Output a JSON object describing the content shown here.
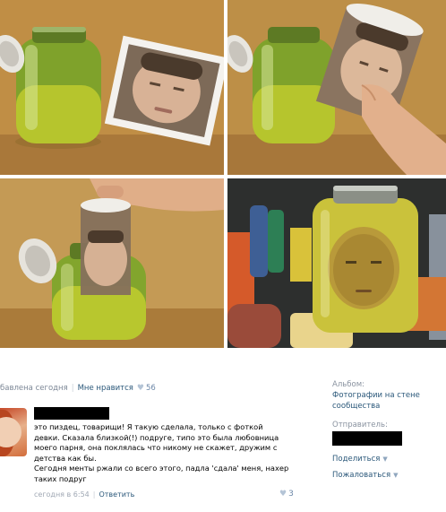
{
  "post": {
    "added_label": "бавлена сегодня",
    "like_label": "Мне нравится",
    "like_count": "56"
  },
  "comment": {
    "lines": [
      "это пиздец, товарищи! Я такую сделала, только с фоткой",
      "девки. Сказала близкой(!) подруге, типо это была любовница",
      "моего парня, она поклялась что никому не скажет, дружим с",
      "детства как бы.",
      "Сегодня менты ржали со всего этого, падла 'сдала' меня, нахер",
      "таких подруг"
    ],
    "time": "сегодня в 6:54",
    "reply_label": "Ответить",
    "like_count": "3"
  },
  "sidebar": {
    "album_label": "Альбом:",
    "album_link": "Фотографии на стене сообщества",
    "sender_label": "Отправитель:",
    "share_label": "Поделиться",
    "report_label": "Пожаловаться"
  },
  "icons": {
    "heart": "heart-icon",
    "dropdown": "chevron-down-icon"
  },
  "colors": {
    "link": "#2b587a",
    "muted": "#7c8796",
    "heart": "#b4c4d6"
  }
}
